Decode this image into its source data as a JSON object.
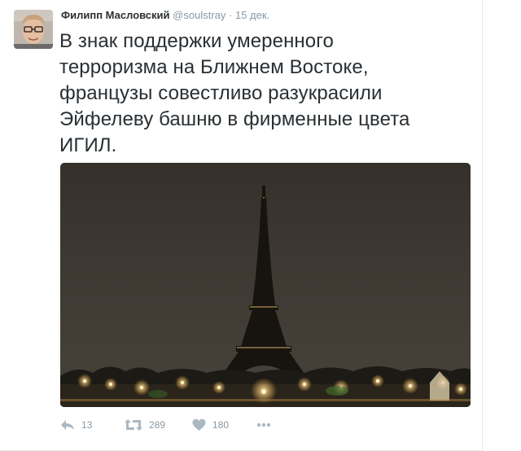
{
  "tweet": {
    "author": {
      "fullname": "Филипп Масловский",
      "username": "@soulstray",
      "avatar_icon": "user-avatar"
    },
    "separator": "·",
    "timestamp": "15 дек.",
    "text_lines": [
      "В знак поддержки умеренного",
      "терроризма на Ближнем Востоке,",
      "французы совестливо разукрасили",
      "Эйфелеву башню в фирменные цвета",
      "ИГИЛ."
    ],
    "media": {
      "icon": "eiffel-tower-night-photo"
    },
    "actions": {
      "reply": {
        "icon": "reply-icon",
        "count": "13"
      },
      "retweet": {
        "icon": "retweet-icon",
        "count": "289"
      },
      "like": {
        "icon": "heart-icon",
        "count": "180"
      },
      "more": {
        "icon": "more-icon"
      }
    }
  },
  "colors": {
    "text": "#292f33",
    "muted": "#8899a6",
    "icon": "#aab8c2",
    "border": "#e1e8ed"
  }
}
